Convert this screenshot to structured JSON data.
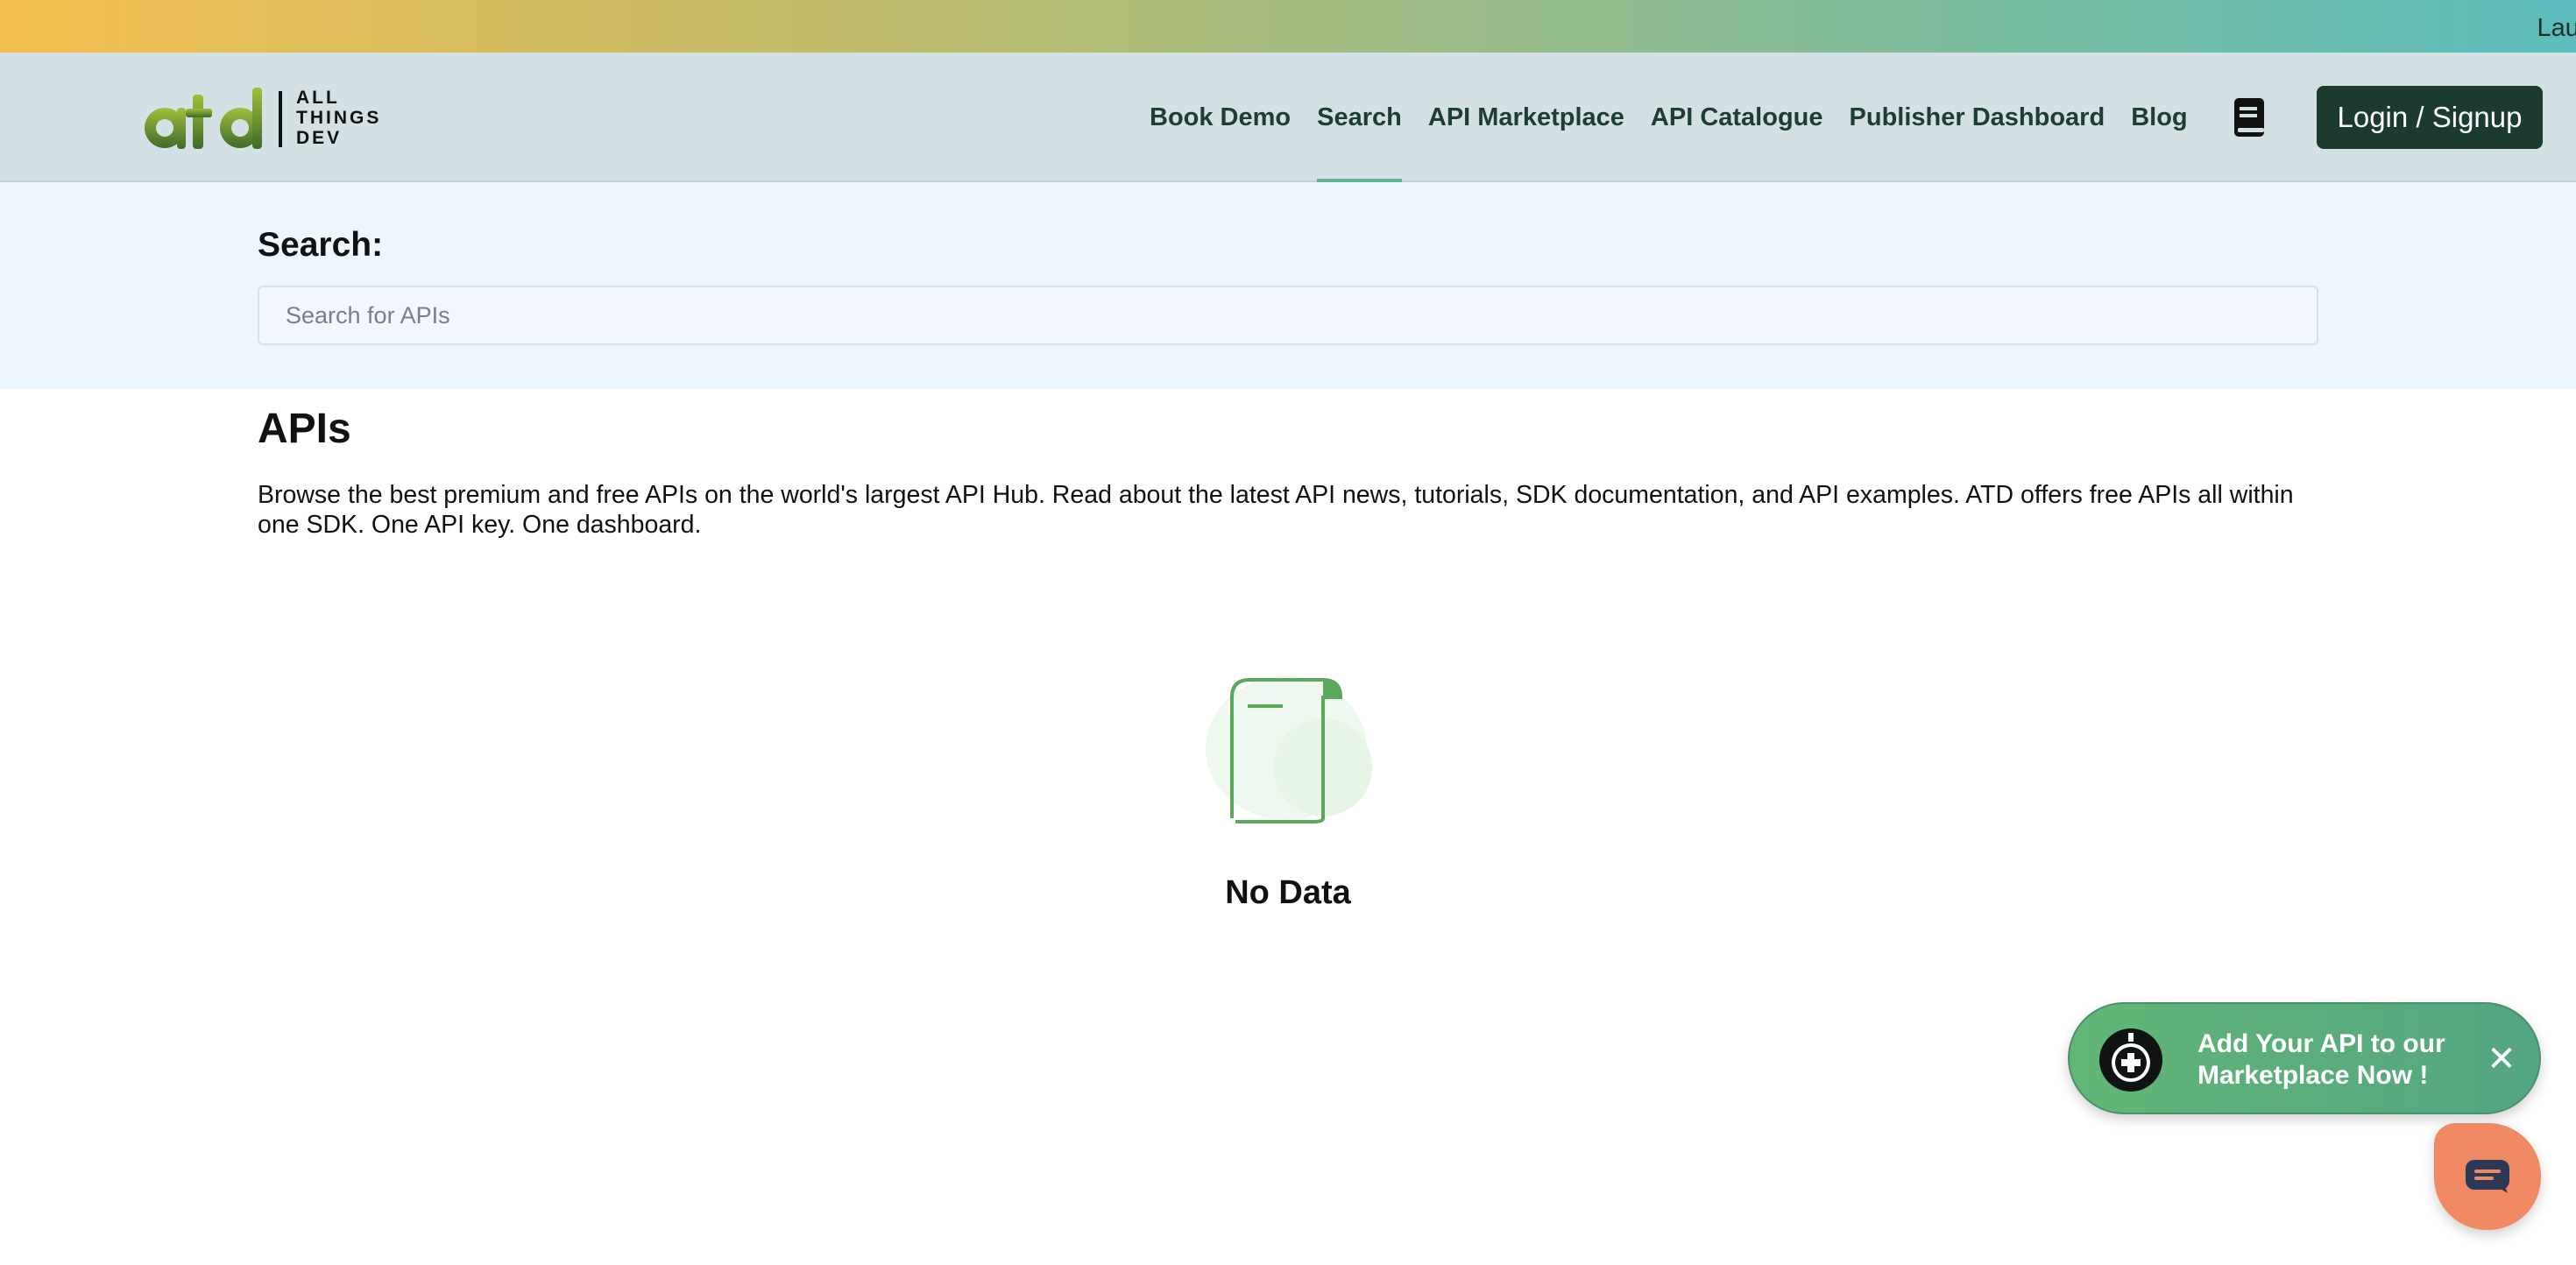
{
  "topbar": {
    "ticker_text": "Laun"
  },
  "brand": {
    "line1": "ALL",
    "line2": "THINGS",
    "line3": "DEV"
  },
  "nav": {
    "items": [
      {
        "label": "Book Demo"
      },
      {
        "label": "Search",
        "active": true
      },
      {
        "label": "API Marketplace"
      },
      {
        "label": "API Catalogue"
      },
      {
        "label": "Publisher Dashboard"
      },
      {
        "label": "Blog"
      }
    ],
    "docs_icon": "book-icon",
    "login_label": "Login / Signup"
  },
  "search": {
    "label": "Search:",
    "placeholder": "Search for APIs",
    "value": ""
  },
  "main": {
    "title": "APIs",
    "description": "Browse the best premium and free APIs on the world's largest API Hub. Read about the latest API news, tutorials, SDK documentation, and API examples. ATD offers free APIs all within one SDK. One API key. One dashboard.",
    "empty_state": "No Data"
  },
  "promo": {
    "text": "Add Your API to our Marketplace Now !",
    "close": "✕"
  },
  "colors": {
    "accent": "#62b38a",
    "button_dark": "#1b3b2f",
    "header_bg": "#d3e1e5",
    "promo_green": "#5cae7c",
    "chat_orange": "#f08a64"
  }
}
